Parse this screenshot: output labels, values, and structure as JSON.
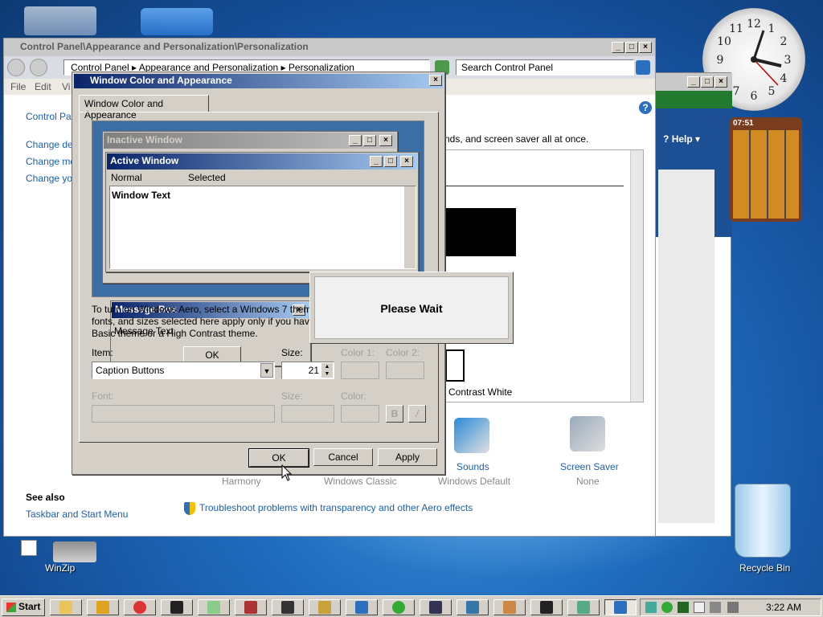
{
  "desktop": {
    "icons": [
      {
        "label": "WinZip"
      },
      {
        "label": "Recycle Bin"
      }
    ]
  },
  "control_panel": {
    "title": "Control Panel\\Appearance and Personalization\\Personalization",
    "breadcrumb": [
      "Control Panel",
      "Appearance and Personalization",
      "Personalization"
    ],
    "search_placeholder": "Search Control Panel",
    "menu": [
      "File",
      "Edit",
      "Vi"
    ],
    "sidebar_links": [
      "Control Panel",
      "Change des",
      "Change mou",
      "Change you"
    ],
    "body_text": "nds, and screen saver all at once.",
    "theme_label": "Contrast White",
    "bottom_items": [
      {
        "label": "Sounds",
        "sub": ""
      },
      {
        "label": "Screen Saver",
        "sub": "None"
      }
    ],
    "theme_sublabels": [
      "Harmony",
      "Windows Classic",
      "Windows Default"
    ],
    "see_also": "See also",
    "see_also_link": "Taskbar and Start Menu",
    "troubleshoot_link": "Troubleshoot problems with transparency and other Aero effects"
  },
  "help_window": {
    "help_label": "Help"
  },
  "dialog": {
    "title": "Window Color and Appearance",
    "tab": "Window Color and Appearance",
    "preview": {
      "inactive_title": "Inactive Window",
      "active_title": "Active Window",
      "menu_normal": "Normal",
      "menu_selected": "Selected",
      "window_text": "Window Text",
      "msgbox_title": "Message Box",
      "msgbox_text": "Message Text",
      "msgbox_ok": "OK"
    },
    "info_line1": "To turn on Windows Aero, select a Windows 7 them",
    "info_line2": "fonts, and sizes selected here apply only if you have",
    "info_line3": "Basic theme or a High Contrast theme.",
    "item_label": "Item:",
    "item_value": "Caption Buttons",
    "size_label": "Size:",
    "size_value": "21",
    "color1_label": "Color 1:",
    "color2_label": "Color 2:",
    "font_label": "Font:",
    "font_size_label": "Size:",
    "font_color_label": "Color:",
    "bold_label": "B",
    "italic_label": "/",
    "ok": "OK",
    "cancel": "Cancel",
    "apply": "Apply"
  },
  "please_wait": {
    "text": "Please Wait"
  },
  "gadget": {
    "time": "07:51"
  },
  "taskbar": {
    "start": "Start",
    "clock": "3:22 AM"
  },
  "colors": {
    "title_active": "#0a246a",
    "desktop": "#1f6bbd"
  }
}
